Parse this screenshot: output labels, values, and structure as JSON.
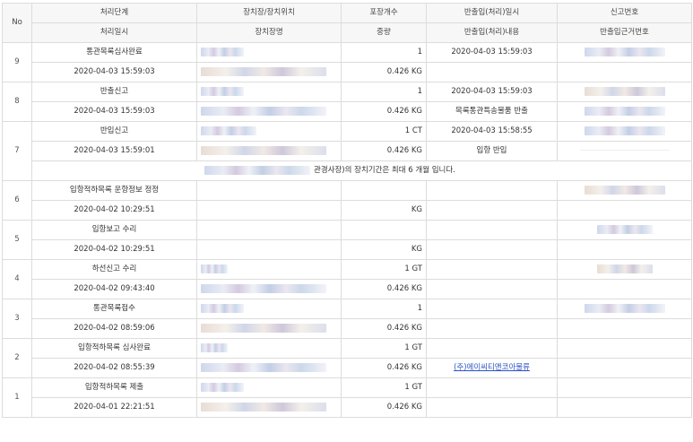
{
  "headers": {
    "no": "No",
    "stage": "처리단계",
    "stage_sub": "처리일시",
    "warehouse": "장치장/장치위치",
    "warehouse_sub": "장치장명",
    "pkg": "포장개수",
    "pkg_sub": "중량",
    "inout": "반출입(처리)일시",
    "inout_sub": "반출입(처리)내용",
    "report": "신고번호",
    "report_sub": "반출입근거번호"
  },
  "rows": {
    "r9": {
      "no": "9",
      "stage": "통관목록심사완료",
      "date": "2020-04-03 15:59:03",
      "pkg": "1",
      "weight": "0.426 KG",
      "inout_date": "2020-04-03 15:59:03",
      "inout_content": ""
    },
    "r8": {
      "no": "8",
      "stage": "반출신고",
      "date": "2020-04-03 15:59:03",
      "pkg": "1",
      "weight": "0.426 KG",
      "inout_date": "2020-04-03 15:59:03",
      "inout_content": "목록통관특송물품 반출"
    },
    "r7": {
      "no": "7",
      "stage": "반입신고",
      "date": "2020-04-03 15:59:01",
      "pkg": "1 CT",
      "weight": "0.426 KG",
      "inout_date": "2020-04-03 15:58:55",
      "inout_content": "입항 반입",
      "notice": "관경사장)의 장치기간은 최대 6 개월 입니다."
    },
    "r6": {
      "no": "6",
      "stage": "입항적하목록 운항정보 정정",
      "date": "2020-04-02 10:29:51",
      "pkg": "",
      "weight": "KG",
      "inout_date": "",
      "inout_content": ""
    },
    "r5": {
      "no": "5",
      "stage": "입항보고 수리",
      "date": "2020-04-02 10:29:51",
      "pkg": "",
      "weight": "KG",
      "inout_date": "",
      "inout_content": ""
    },
    "r4": {
      "no": "4",
      "stage": "하선신고 수리",
      "date": "2020-04-02 09:43:40",
      "pkg": "1 GT",
      "weight": "0.426 KG",
      "inout_date": "",
      "inout_content": ""
    },
    "r3": {
      "no": "3",
      "stage": "통관목록접수",
      "date": "2020-04-02 08:59:06",
      "pkg": "1",
      "weight": "0.426 KG",
      "inout_date": "",
      "inout_content": ""
    },
    "r2": {
      "no": "2",
      "stage": "입항적하목록 심사완료",
      "date": "2020-04-02 08:55:39",
      "pkg": "1 GT",
      "weight": "0.426 KG",
      "inout_date": "",
      "inout_content": "(주)에이씨티앤코아물류"
    },
    "r1": {
      "no": "1",
      "stage": "입항적하목록 제출",
      "date": "2020-04-01 22:21:51",
      "pkg": "1 GT",
      "weight": "0.426 KG",
      "inout_date": "",
      "inout_content": ""
    }
  }
}
